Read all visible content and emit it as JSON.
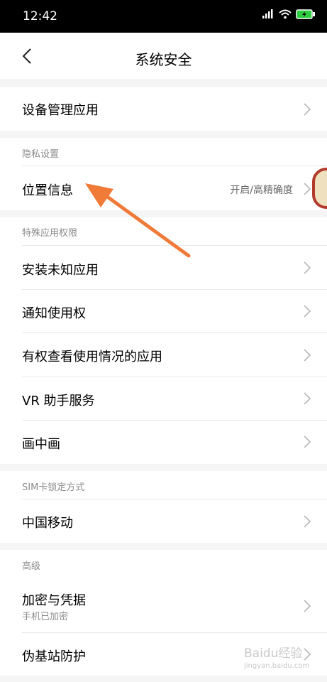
{
  "status_bar": {
    "time": "12:42",
    "signal": "HD",
    "icons": [
      "signal-icon",
      "wifi-icon",
      "battery-charging-icon"
    ]
  },
  "header": {
    "title": "系统安全",
    "back_icon": "chevron-left-icon"
  },
  "rows": {
    "device_admin": "设备管理应用",
    "location": {
      "label": "位置信息",
      "value": "开启/高精确度"
    },
    "install_unknown": "安装未知应用",
    "notification_access": "通知使用权",
    "usage_access": "有权查看使用情况的应用",
    "vr_helper": "VR 助手服务",
    "pip": "画中画",
    "carrier": "中国移动",
    "encryption": {
      "label": "加密与凭据",
      "sub": "手机已加密"
    },
    "fake_bs": "伪基站防护"
  },
  "sections": {
    "privacy": "隐私设置",
    "special_perms": "特殊应用权限",
    "sim_lock": "SIM卡锁定方式",
    "advanced": "高级"
  },
  "watermark": {
    "brand": "Baidu经验",
    "url": "jingyan.baidu.com"
  },
  "colors": {
    "arrow": "#f07a38",
    "accent": "#2ecc40"
  }
}
